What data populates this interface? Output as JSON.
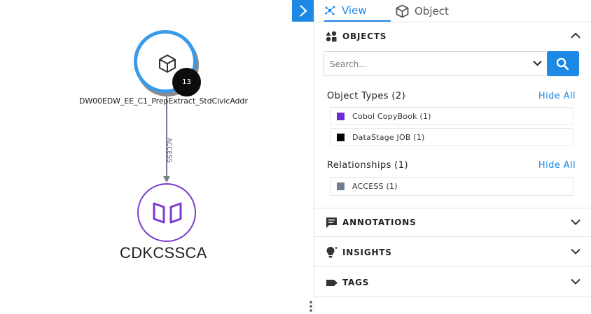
{
  "graph": {
    "job_node": {
      "label": "DW00EDW_EE_C1_PrepExtract_StdCivicAddr",
      "badge_count": "13",
      "icon": "cube-icon",
      "border_color": "#3a9ae8"
    },
    "edge": {
      "label": "ACCESS",
      "color": "#6f7f8f"
    },
    "copybook_node": {
      "label": "CDKCSSCA",
      "icon": "book-open-icon",
      "border_color": "#7b3bd1"
    }
  },
  "panel": {
    "tabs": [
      {
        "label": "View",
        "icon": "network-icon",
        "active": true
      },
      {
        "label": "Object",
        "icon": "cube-icon",
        "active": false
      }
    ],
    "objects": {
      "title": "OBJECTS",
      "icon": "shapes-icon",
      "search_placeholder": "Search...",
      "object_types": {
        "title": "Object Types (2)",
        "hide_all": "Hide All",
        "items": [
          {
            "label": "Cobol CopyBook (1)",
            "color": "#6a2ed8"
          },
          {
            "label": "DataStage JOB (1)",
            "color": "#000000"
          }
        ]
      },
      "relationships": {
        "title": "Relationships (1)",
        "hide_all": "Hide All",
        "items": [
          {
            "label": "ACCESS (1)",
            "color": "#6f7f8f"
          }
        ]
      }
    },
    "annotations": {
      "title": "ANNOTATIONS",
      "icon": "comment-icon"
    },
    "insights": {
      "title": "INSIGHTS",
      "icon": "lightbulb-icon"
    },
    "tags": {
      "title": "TAGS",
      "icon": "tag-icon"
    }
  },
  "colors": {
    "accent": "#1e88e5"
  }
}
